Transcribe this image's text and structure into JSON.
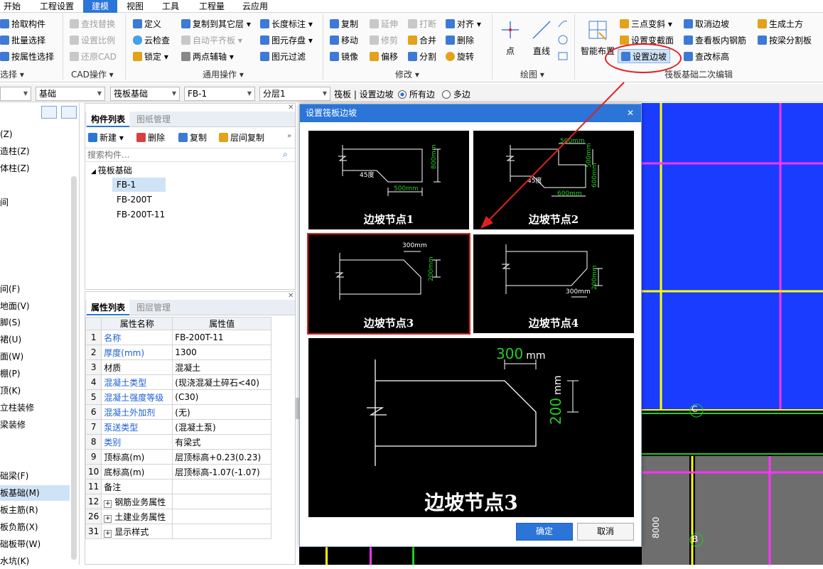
{
  "menu": [
    "开始",
    "工程设置",
    "建模",
    "视图",
    "工具",
    "工程量",
    "云应用"
  ],
  "ribbon": {
    "select": {
      "pick": "拾取构件",
      "batch": "批量选择",
      "attr": "按属性选择",
      "group": "选择 ▾"
    },
    "cad": {
      "find": "查找替换",
      "ratio": "设置比例",
      "restore": "还原CAD",
      "group": "CAD操作 ▾"
    },
    "general": {
      "define": "定义",
      "cloud": "云检查",
      "lock": "锁定 ▾",
      "copy_layer": "复制到其它层 ▾",
      "auto_plane": "自动平齐板 ▾",
      "two_axis": "两点辅轴 ▾",
      "length": "长度标注 ▾",
      "store": "图元存盘 ▾",
      "filter": "图元过滤",
      "group": "通用操作 ▾"
    },
    "modify": {
      "copy": "复制",
      "move": "移动",
      "mirror": "镜像",
      "extend": "延伸",
      "trim": "修剪",
      "offset": "偏移",
      "break": "打断",
      "merge": "合并",
      "split": "分割",
      "align": "对齐 ▾",
      "delete": "删除",
      "rotate": "旋转",
      "group": "修改 ▾"
    },
    "draw": {
      "point": "点",
      "line": "直线",
      "group": "绘图 ▾"
    },
    "secondary": {
      "smart": "智能布置",
      "three_point": "三点变斜 ▾",
      "set_section": "设置变截面",
      "set_slope": "设置边坡",
      "cancel_slope": "取消边坡",
      "view_rebar": "查看板内钢筋",
      "modify_elev": "查改标高",
      "gen_earth": "生成土方",
      "split_by_beam": "按梁分割板",
      "group": "筏板基础二次编辑"
    }
  },
  "toolbar2": {
    "dd_floor": "",
    "dd_type": "基础",
    "dd_member": "筏板基础",
    "dd_name": "FB-1",
    "dd_layer": "分层1",
    "hint": "筏板 | 设置边坡",
    "opt_all": "所有边",
    "opt_multi": "多边"
  },
  "leftnav": [
    "(Z)",
    "造柱(Z)",
    "体柱(Z)",
    "",
    "间",
    "",
    "",
    "",
    "",
    "间(F)",
    "地面(V)",
    "脚(S)",
    "裙(U)",
    "面(W)",
    "棚(P)",
    "顶(K)",
    "立柱装修",
    "梁装修",
    "",
    "",
    "础梁(F)",
    "板基础(M)",
    "板主筋(R)",
    "板负筋(X)",
    "础板带(W)",
    "水坑(K)"
  ],
  "component_panel": {
    "tab1": "构件列表",
    "tab2": "图纸管理",
    "new": "新建 ▾",
    "delete": "删除",
    "copy": "复制",
    "floor_copy": "层间复制",
    "search_placeholder": "搜索构件...",
    "root": "筏板基础",
    "items": [
      "FB-1",
      "FB-200T",
      "FB-200T-11"
    ]
  },
  "property_panel": {
    "tab1": "属性列表",
    "tab2": "图层管理",
    "col_name": "属性名称",
    "col_value": "属性值",
    "rows": [
      {
        "no": "1",
        "name": "名称",
        "value": "FB-200T-11"
      },
      {
        "no": "2",
        "name": "厚度(mm)",
        "value": "1300"
      },
      {
        "no": "3",
        "name": "材质",
        "value": "混凝土"
      },
      {
        "no": "4",
        "name": "混凝土类型",
        "value": "(现浇混凝土碎石<40)"
      },
      {
        "no": "5",
        "name": "混凝土强度等级",
        "value": "(C30)"
      },
      {
        "no": "6",
        "name": "混凝土外加剂",
        "value": "(无)"
      },
      {
        "no": "7",
        "name": "泵送类型",
        "value": "(混凝土泵)"
      },
      {
        "no": "8",
        "name": "类别",
        "value": "有梁式"
      },
      {
        "no": "9",
        "name": "顶标高(m)",
        "value": "层顶标高+0.23(0.23)"
      },
      {
        "no": "10",
        "name": "底标高(m)",
        "value": "层顶标高-1.07(-1.07)"
      },
      {
        "no": "11",
        "name": "备注",
        "value": ""
      },
      {
        "no": "12",
        "name": "钢筋业务属性",
        "value": ""
      },
      {
        "no": "26",
        "name": "土建业务属性",
        "value": ""
      },
      {
        "no": "31",
        "name": "显示样式",
        "value": ""
      }
    ]
  },
  "dialog": {
    "title": "设置筏板边坡",
    "nodes": [
      {
        "caption": "边坡节点1",
        "dim_a": "500mm",
        "dim_b": "800mm",
        "angle": "45度"
      },
      {
        "caption": "边坡节点2",
        "dim_a": "500mm",
        "dim_b": "600mm",
        "dim_c": "500mm",
        "dim_d": "600mm",
        "angle": "45度"
      },
      {
        "caption": "边坡节点3",
        "dim_a": "300mm",
        "dim_b": "200mm"
      },
      {
        "caption": "边坡节点4",
        "dim_a": "300mm",
        "dim_b": "200mm"
      }
    ],
    "preview": {
      "caption": "边坡节点3",
      "dim_a": "300",
      "dim_a_unit": "mm",
      "dim_b": "200",
      "dim_b_unit": "mm"
    },
    "ok": "确定",
    "cancel": "取消"
  },
  "canvas": {
    "axis_c": "C",
    "axis_b": "B",
    "dim": "8000"
  },
  "colors": {
    "accent": "#2b75d8",
    "highlight": "#e02020",
    "dim_green": "#22cc22",
    "grid_yellow": "#ffff00",
    "grid_magenta": "#ff33ff",
    "slab_blue": "#1a3cff",
    "slab_gray": "#6e6e6e"
  }
}
